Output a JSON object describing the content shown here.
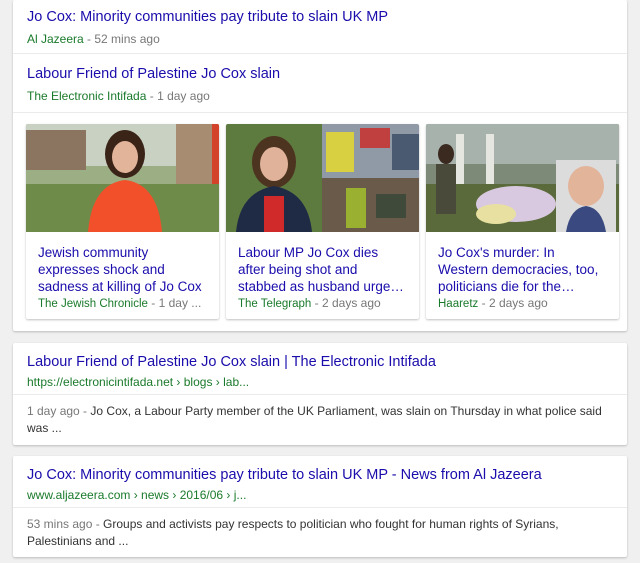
{
  "top_news": [
    {
      "title": "Jo Cox: Minority communities pay tribute to slain UK MP",
      "source": "Al Jazeera",
      "age": "52 mins ago"
    },
    {
      "title": "Labour Friend of Palestine Jo Cox slain",
      "source": "The Electronic Intifada",
      "age": "1 day ago"
    }
  ],
  "meta_separator": " - ",
  "thumbnails": [
    {
      "title": "Jewish community expresses shock and sadness at killing of Jo Cox",
      "source": "The Jewish Chronicle",
      "age": "1 day ..."
    },
    {
      "title": "Labour MP Jo Cox dies after being shot and stabbed as husband urge…",
      "source": "The Telegraph",
      "age": "2 days ago"
    },
    {
      "title": "Jo Cox's murder: In Western democracies, too, politicians die for the…",
      "source": "Haaretz",
      "age": "2 days ago"
    }
  ],
  "results": [
    {
      "title": "Labour Friend of Palestine Jo Cox slain | The Electronic Intifada",
      "url": "https://electronicintifada.net › blogs › lab...",
      "date": "1 day ago",
      "snippet": "Jo Cox, a Labour Party member of the UK Parliament, was slain on Thursday in what police said was ..."
    },
    {
      "title": "Jo Cox: Minority communities pay tribute to slain UK MP - News from Al Jazeera",
      "url": "www.aljazeera.com › news › 2016/06 › j...",
      "date": "53 mins ago",
      "snippet": "Groups and activists pay respects to politician who fought for human rights of Syrians, Palestinians and ..."
    }
  ]
}
